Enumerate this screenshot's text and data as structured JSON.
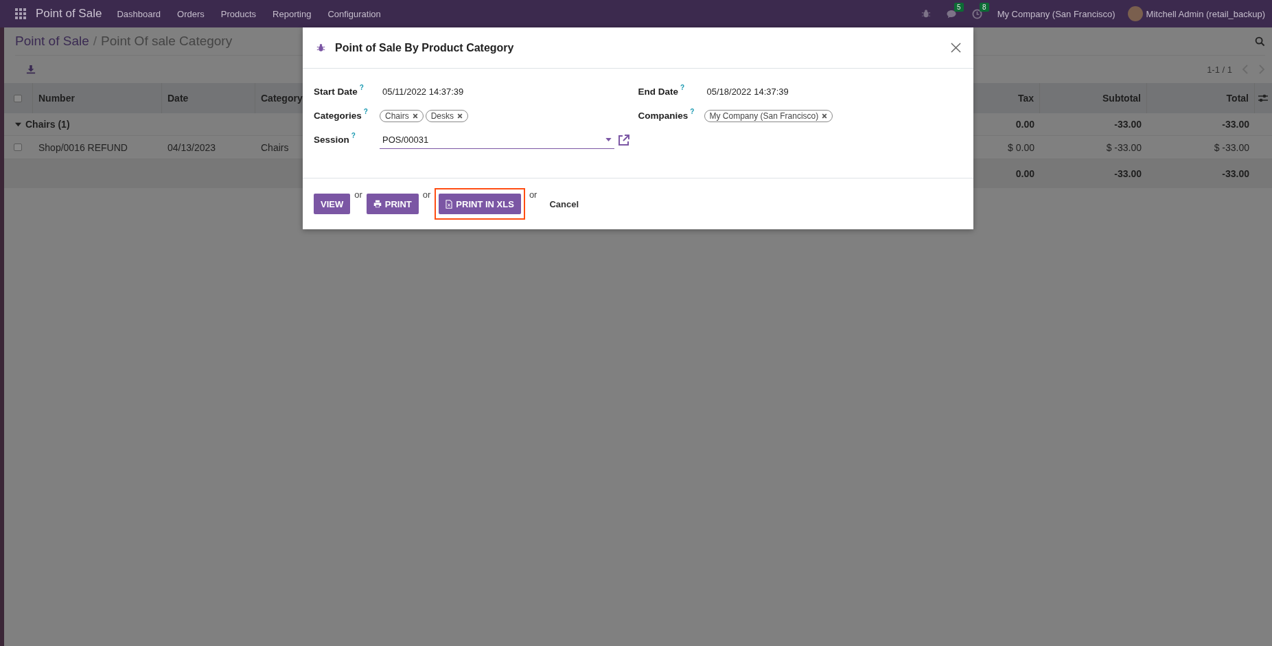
{
  "navbar": {
    "app_name": "Point of Sale",
    "menus": [
      "Dashboard",
      "Orders",
      "Products",
      "Reporting",
      "Configuration"
    ],
    "messages_count": "5",
    "activities_count": "8",
    "company": "My Company (San Francisco)",
    "user": "Mitchell Admin (retail_backup)"
  },
  "breadcrumb": {
    "separator": "/",
    "items": [
      {
        "label": "Point of Sale"
      },
      {
        "label": "Point Of sale Category"
      }
    ]
  },
  "pager": "1-1 / 1",
  "table": {
    "select_all": {
      "checked": false
    },
    "columns": [
      {
        "label": "Number"
      },
      {
        "label": "Date"
      },
      {
        "label": "Category"
      },
      {
        "label": "Tax"
      },
      {
        "label": "Subtotal"
      },
      {
        "label": "Total"
      }
    ],
    "groups": [
      {
        "label": "Chairs (1)",
        "expanded": true,
        "tax": "0.00",
        "subtotal": "-33.00",
        "total": "-33.00"
      }
    ],
    "rows": [
      {
        "checked": false,
        "cells": [
          "Shop/0016 REFUND",
          "04/13/2023",
          "Chairs",
          "$ 0.00",
          "$ -33.00",
          "$ -33.00"
        ]
      }
    ],
    "totals": {
      "tax": "0.00",
      "subtotal": "-33.00",
      "total": "-33.00"
    }
  },
  "dialog": {
    "title": "Point of Sale By Product Category",
    "fields_left": [
      {
        "label": "Start Date",
        "help": "?",
        "kind": "text",
        "value": "05/11/2022 14:37:39"
      },
      {
        "label": "Categories",
        "help": "?",
        "kind": "tags",
        "tags": [
          "Chairs",
          "Desks"
        ]
      },
      {
        "label": "Session",
        "help": "?",
        "kind": "select",
        "value": "POS/00031"
      }
    ],
    "fields_right": [
      {
        "label": "End Date",
        "help": "?",
        "kind": "text",
        "value": "05/18/2022 14:37:39"
      },
      {
        "label": "Companies",
        "help": "?",
        "kind": "tags",
        "tags": [
          "My Company (San Francisco)"
        ]
      }
    ],
    "footer": [
      {
        "kind": "button",
        "label": "VIEW",
        "highlighted": false
      },
      {
        "kind": "separator",
        "label": "or"
      },
      {
        "kind": "print",
        "label": "PRINT",
        "highlighted": false
      },
      {
        "kind": "separator",
        "label": "or"
      },
      {
        "kind": "export",
        "label": "PRINT IN XLS",
        "highlighted": true
      },
      {
        "kind": "separator",
        "label": "or"
      },
      {
        "kind": "link",
        "label": "Cancel"
      }
    ]
  }
}
